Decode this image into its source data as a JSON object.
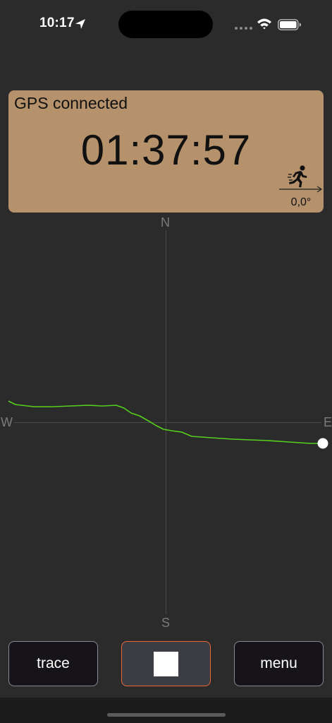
{
  "status_bar": {
    "time": "10:17",
    "icons": [
      "location-arrow-icon",
      "signal-dots-icon",
      "wifi-icon",
      "battery-icon"
    ]
  },
  "info_panel": {
    "gps_status": "GPS connected",
    "elapsed_time": "01:37:57",
    "heading": "0,0°",
    "icons": [
      "runner-icon",
      "direction-arrow-icon"
    ],
    "background_color": "#b5926b"
  },
  "compass": {
    "north_label": "N",
    "south_label": "S",
    "west_label": "W",
    "east_label": "E",
    "track_color": "#56d01e"
  },
  "controls": {
    "trace_label": "trace",
    "stop_icon": "stop-square-icon",
    "menu_label": "menu",
    "stop_border_color": "#e5683a"
  }
}
